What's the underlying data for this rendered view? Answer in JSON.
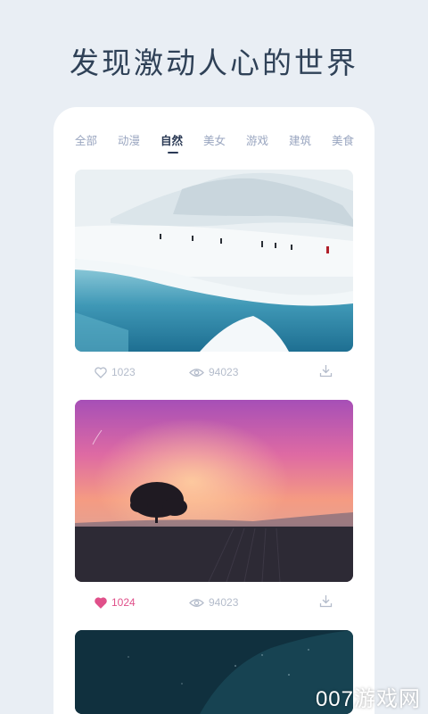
{
  "headline": "发现激动人心的世界",
  "tabs": [
    {
      "label": "全部",
      "active": false
    },
    {
      "label": "动漫",
      "active": false
    },
    {
      "label": "自然",
      "active": true
    },
    {
      "label": "美女",
      "active": false
    },
    {
      "label": "游戏",
      "active": false
    },
    {
      "label": "建筑",
      "active": false
    },
    {
      "label": "美食",
      "active": false
    }
  ],
  "posts": [
    {
      "scene": "snow-glacier",
      "likes": "1023",
      "views": "94023",
      "liked": false
    },
    {
      "scene": "sunset-tree",
      "likes": "1024",
      "views": "94023",
      "liked": true
    },
    {
      "scene": "night-sky",
      "likes": "",
      "views": "",
      "liked": false
    }
  ],
  "icons": {
    "like": "heart-icon",
    "view": "eye-icon",
    "download": "download-icon"
  },
  "colors": {
    "accent_liked": "#e0508a",
    "active_tab": "#2b3a55",
    "inactive_tab": "#9aa6c0",
    "background": "#e9eef4"
  },
  "watermark": "007游戏网"
}
